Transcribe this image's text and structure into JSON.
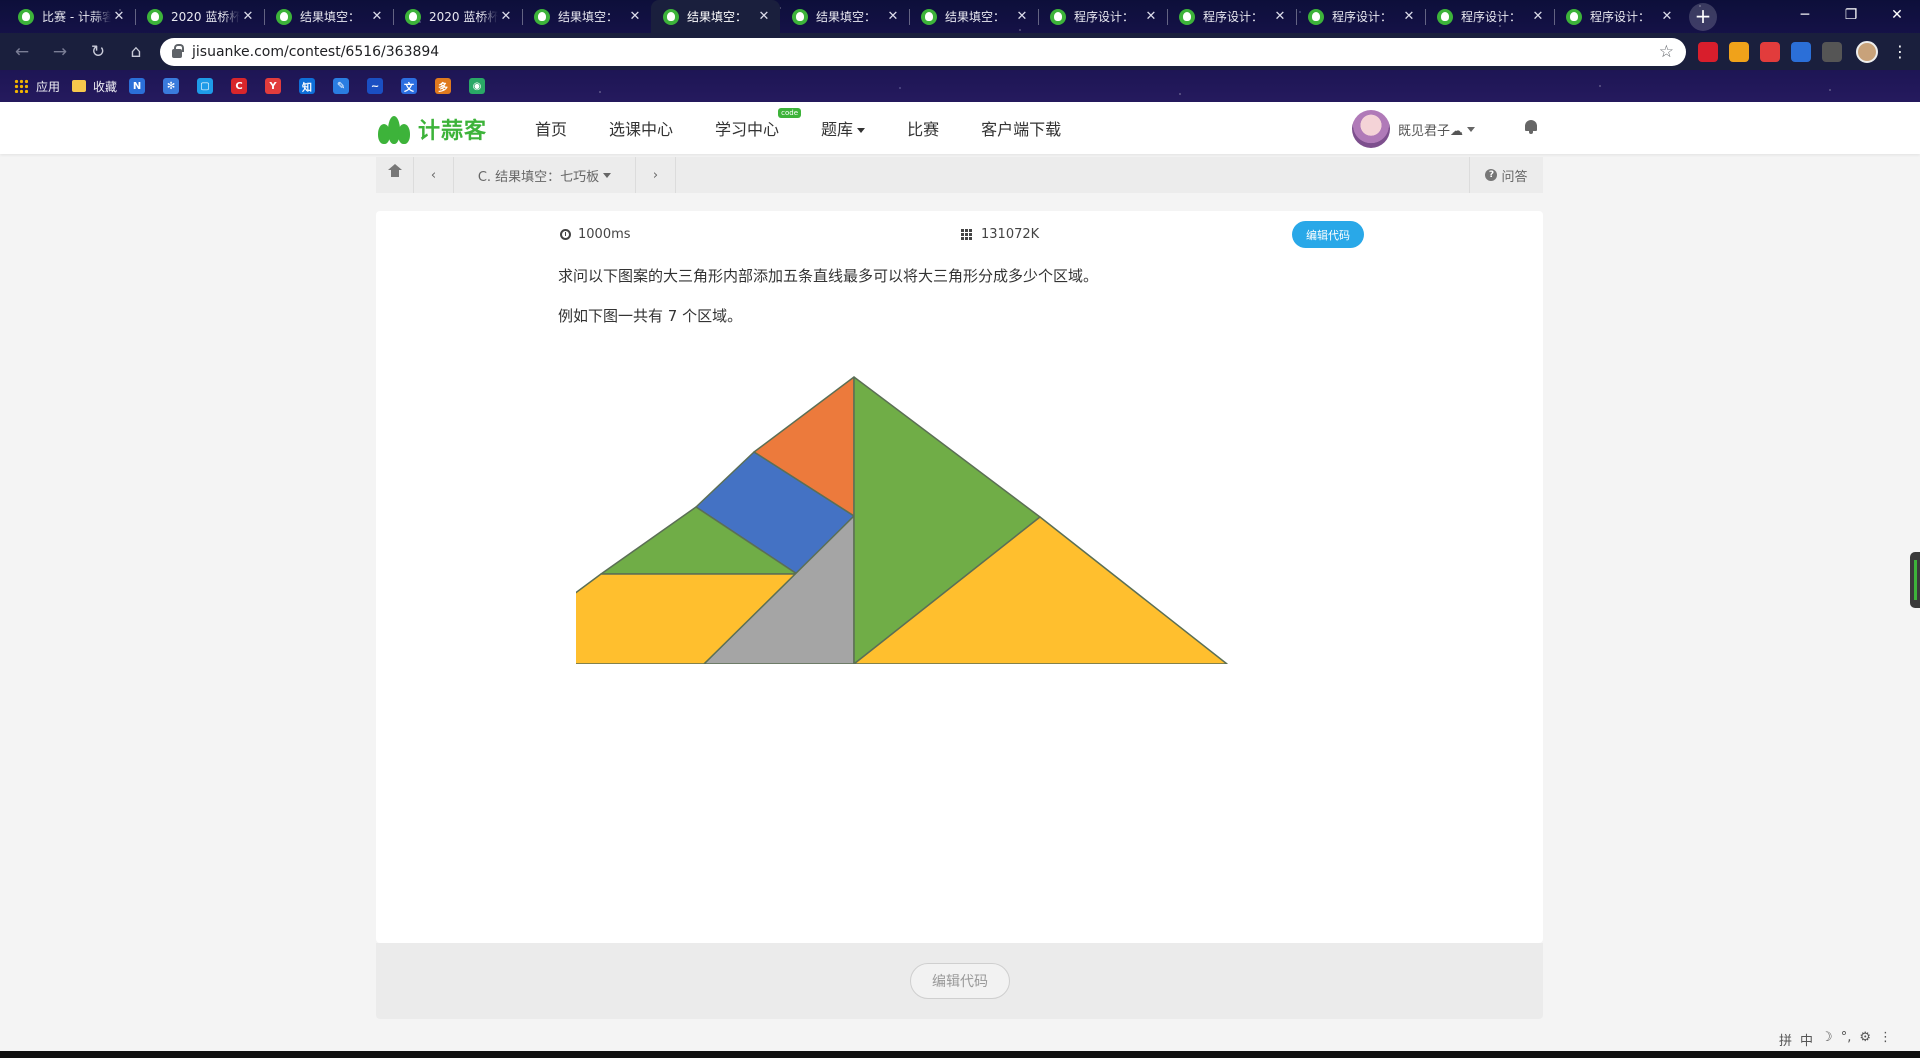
{
  "browser": {
    "tabs": [
      {
        "title": "比赛 - 计蒜客",
        "active": false
      },
      {
        "title": "2020 蓝桥杯",
        "active": false
      },
      {
        "title": "结果填空：",
        "active": false
      },
      {
        "title": "2020 蓝桥杯",
        "active": false
      },
      {
        "title": "结果填空：",
        "active": false
      },
      {
        "title": "结果填空：",
        "active": true
      },
      {
        "title": "结果填空：",
        "active": false
      },
      {
        "title": "结果填空：",
        "active": false
      },
      {
        "title": "程序设计：",
        "active": false
      },
      {
        "title": "程序设计：",
        "active": false
      },
      {
        "title": "程序设计：",
        "active": false
      },
      {
        "title": "程序设计：",
        "active": false
      },
      {
        "title": "程序设计：",
        "active": false
      }
    ],
    "url": "jisuanke.com/contest/6516/363894",
    "bookmarks": {
      "apps": "应用",
      "favorites": "收藏",
      "icons": [
        {
          "text": "N",
          "color": "#2b6fd8"
        },
        {
          "text": "✻",
          "color": "#3a7bdc"
        },
        {
          "text": "▢",
          "color": "#1e9be8"
        },
        {
          "text": "C",
          "color": "#d8262b"
        },
        {
          "text": "Y",
          "color": "#e23c3c"
        },
        {
          "text": "知",
          "color": "#0f6fd8"
        },
        {
          "text": "✎",
          "color": "#2a7de1"
        },
        {
          "text": "~",
          "color": "#1a4fc2"
        },
        {
          "text": "文",
          "color": "#2c6ee0"
        },
        {
          "text": "多",
          "color": "#e07a1e"
        },
        {
          "text": "◉",
          "color": "#2aa866"
        }
      ]
    },
    "extension_colors": [
      "#d81e2c",
      "#f0a21a",
      "#e23c3c",
      "#2b6fd8",
      "#555555"
    ]
  },
  "site": {
    "logo_text": "计蒜客",
    "nav": [
      {
        "label": "首页",
        "has_caret": false,
        "badge": ""
      },
      {
        "label": "选课中心",
        "has_caret": false,
        "badge": ""
      },
      {
        "label": "学习中心",
        "has_caret": false,
        "badge": "code"
      },
      {
        "label": "题库",
        "has_caret": true,
        "badge": ""
      },
      {
        "label": "比赛",
        "has_caret": false,
        "badge": ""
      },
      {
        "label": "客户端下载",
        "has_caret": false,
        "badge": ""
      }
    ],
    "username": "既见君子☁"
  },
  "problem_nav": {
    "current": "C. 结果填空：七巧板",
    "qa": "问答"
  },
  "problem": {
    "time_limit": "1000ms",
    "memory_limit": "131072K",
    "edit_code": "编辑代码",
    "statement": "求问以下图案的大三角形内部添加五条直线最多可以将大三角形分成多少个区域。",
    "example": "例如下图一共有 7 个区域。",
    "tangram_colors": {
      "orange": "#ec7a3c",
      "blue": "#4472c4",
      "green": "#70ad47",
      "yellow": "#ffbf2e",
      "gray": "#a5a5a5"
    }
  },
  "footer": {
    "edit_code": "编辑代码"
  },
  "ime": [
    "拼",
    "中",
    "☽",
    "°,",
    "⚙",
    "⋮"
  ]
}
